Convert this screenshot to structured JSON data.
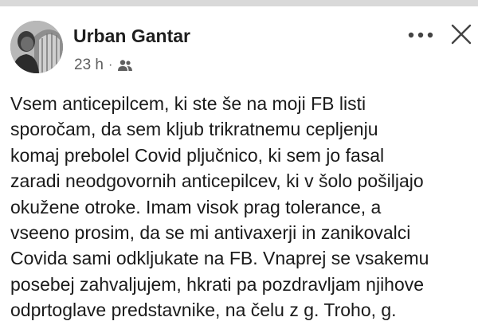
{
  "post": {
    "author": "Urban Gantar",
    "time": "23 h",
    "separator": "·",
    "audience_icon": "friends-icon",
    "more_icon": "more-options-icon",
    "close_icon": "close-icon",
    "body_lines": [
      "Vsem anticepilcem, ki ste še na moji FB listi",
      "sporočam, da sem kljub trikratnemu cepljenju",
      "komaj prebolel Covid pljučnico, ki sem jo fasal",
      "zaradi neodgovornih anticepilcev, ki v šolo pošiljajo",
      "okužene otroke. Imam visok prag tolerance, a",
      "vseeno prosim, da se mi antivaxerji in zanikovalci",
      "Covida sami odkljukate na FB. Vnaprej se vsakemu",
      "posebej zahvaljujem, hkrati pa pozdravljam njihove",
      "odprtoglave predstavnike, na čelu z g. Troho, g."
    ]
  },
  "colors": {
    "name": "#1e1e1e",
    "meta": "#5f5f5f",
    "body": "#1a1a1a",
    "top_strip": "#d9d9d9"
  }
}
